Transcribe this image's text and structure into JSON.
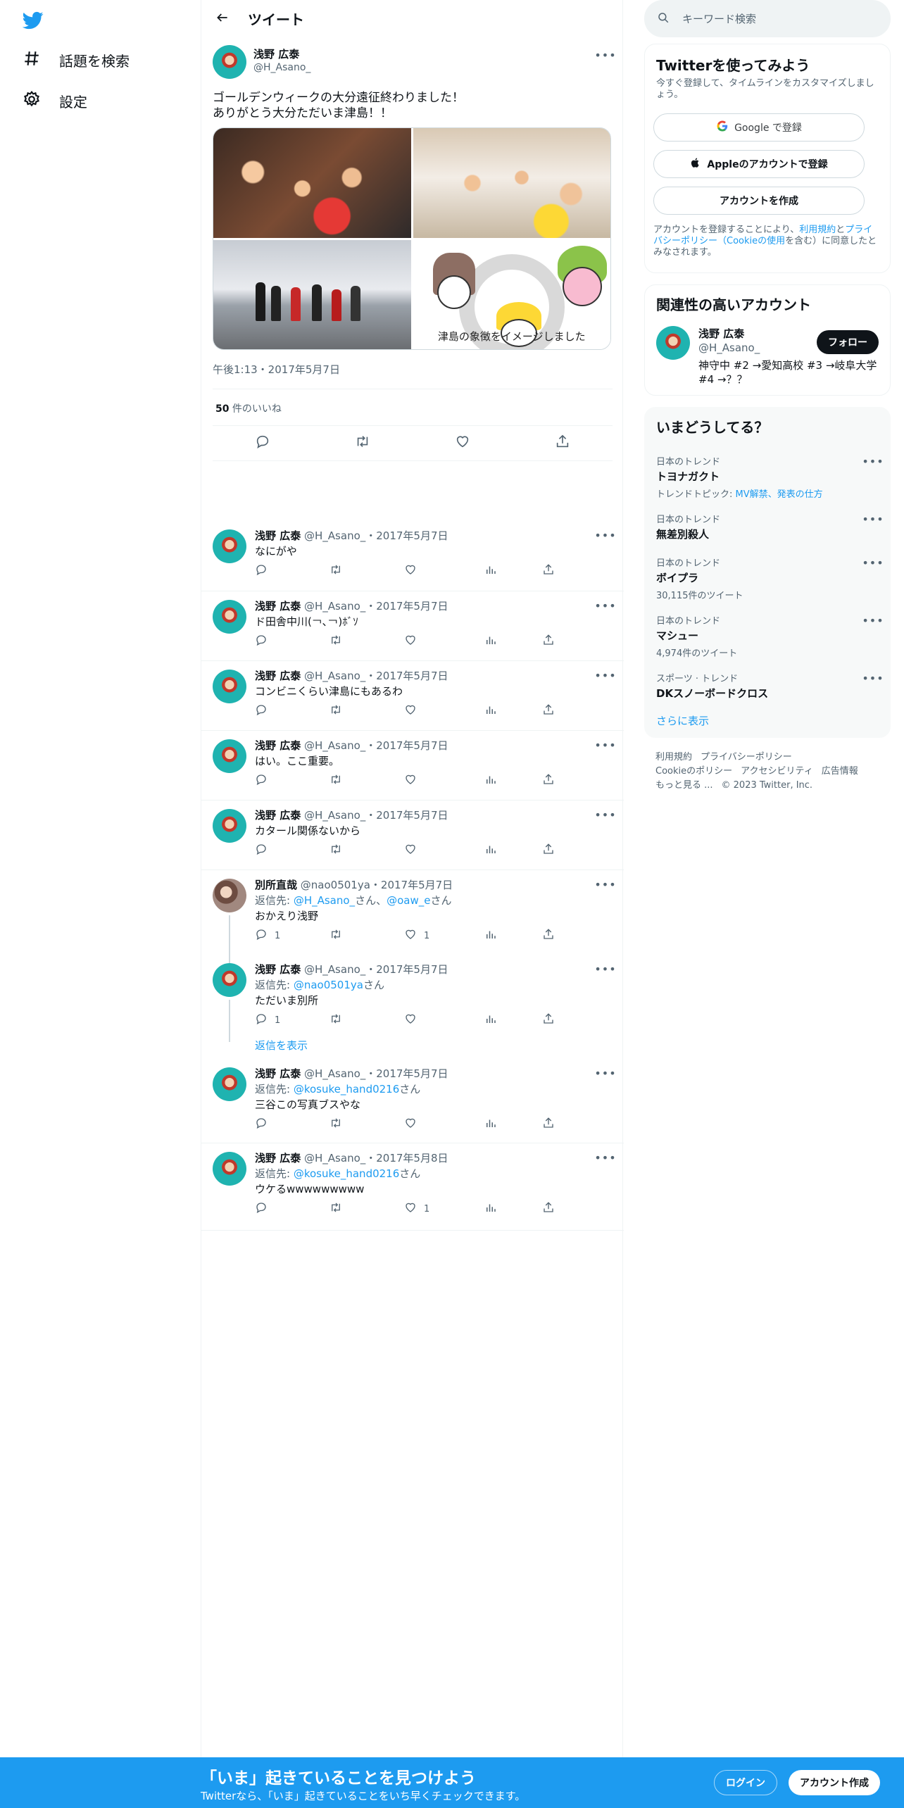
{
  "nav": {
    "explore_label": "話題を検索",
    "settings_label": "設定"
  },
  "header": {
    "title": "ツイート"
  },
  "focal_tweet": {
    "name": "浅野 広泰",
    "handle": "@H_Asano_",
    "text": "ゴールデンウィークの大分遠征終わりました！\nありがとう大分ただいま津島！！",
    "image_caption": "津島の象徴をイメージしました",
    "timestamp": "午後1:13・2017年5月7日",
    "like_count": "50",
    "like_label": " 件のいいね"
  },
  "replies": [
    {
      "name": "浅野 広泰",
      "meta": "@H_Asano_・2017年5月7日",
      "reply_to_prefix": "",
      "reply_to": "",
      "reply_to_suffix": "",
      "text": "なにがや",
      "reply_count": "",
      "like_count": ""
    },
    {
      "name": "浅野 広泰",
      "meta": "@H_Asano_・2017年5月7日",
      "reply_to_prefix": "",
      "reply_to": "",
      "reply_to_suffix": "",
      "text": "ド田舎中川(￢､￢)ﾎﾞｿ",
      "reply_count": "",
      "like_count": ""
    },
    {
      "name": "浅野 広泰",
      "meta": "@H_Asano_・2017年5月7日",
      "reply_to_prefix": "",
      "reply_to": "",
      "reply_to_suffix": "",
      "text": "コンビニくらい津島にもあるわ",
      "reply_count": "",
      "like_count": ""
    },
    {
      "name": "浅野 広泰",
      "meta": "@H_Asano_・2017年5月7日",
      "reply_to_prefix": "",
      "reply_to": "",
      "reply_to_suffix": "",
      "text": "はい。ここ重要。",
      "reply_count": "",
      "like_count": ""
    },
    {
      "name": "浅野 広泰",
      "meta": "@H_Asano_・2017年5月7日",
      "reply_to_prefix": "",
      "reply_to": "",
      "reply_to_suffix": "",
      "text": "カタール関係ないから",
      "reply_count": "",
      "like_count": ""
    },
    {
      "name": "別所直哉",
      "meta": "@nao0501ya・2017年5月7日",
      "reply_to_prefix": "返信先: ",
      "reply_to": "@H_Asano_",
      "reply_to_suffix": "さん、",
      "reply_to2": "@oaw_e",
      "reply_to_suffix2": "さん",
      "text": "おかえり浅野",
      "reply_count": "1",
      "like_count": "1"
    },
    {
      "name": "浅野 広泰",
      "meta": "@H_Asano_・2017年5月7日",
      "reply_to_prefix": "返信先: ",
      "reply_to": "@nao0501ya",
      "reply_to_suffix": "さん",
      "text": "ただいま別所",
      "reply_count": "1",
      "like_count": ""
    },
    {
      "name": "浅野 広泰",
      "meta": "@H_Asano_・2017年5月7日",
      "reply_to_prefix": "返信先: ",
      "reply_to": "@kosuke_hand0216",
      "reply_to_suffix": "さん",
      "text": "三谷この写真ブスやな",
      "reply_count": "",
      "like_count": ""
    },
    {
      "name": "浅野 広泰",
      "meta": "@H_Asano_・2017年5月8日",
      "reply_to_prefix": "返信先: ",
      "reply_to": "@kosuke_hand0216",
      "reply_to_suffix": "さん",
      "text": "ウケるwwwwwwwww",
      "reply_count": "",
      "like_count": "1"
    }
  ],
  "show_replies_label": "返信を表示",
  "sidebar": {
    "search_placeholder": "キーワード検索",
    "signup": {
      "title": "Twitterを使ってみよう",
      "subtitle": "今すぐ登録して、タイムラインをカスタマイズしましょう。",
      "google_label": "Google で登録",
      "apple_label": "Appleのアカウントで登録",
      "create_label": "アカウントを作成",
      "legal_prefix": "アカウントを登録することにより、",
      "legal_terms": "利用規約",
      "legal_and": "と",
      "legal_privacy": "プライバシーポリシー（Cookieの使用",
      "legal_suffix": "を含む）に同意したとみなされます。"
    },
    "relevant": {
      "title": "関連性の高いアカウント",
      "name": "浅野 広泰",
      "handle": "@H_Asano_",
      "bio": "神守中 #2 →愛知高校 #3 →岐阜大学 #4 →？？",
      "follow_label": "フォロー"
    },
    "trends": {
      "title": "いまどうしてる？",
      "items": [
        {
          "context": "日本のトレンド",
          "name": "トヨナガクト",
          "sub_prefix": "トレンドトピック: ",
          "sub_link": "MV解禁、発表の仕方"
        },
        {
          "context": "日本のトレンド",
          "name": "無差別殺人",
          "sub_prefix": "",
          "sub_link": ""
        },
        {
          "context": "日本のトレンド",
          "name": "ボイプラ",
          "sub_prefix": "30,115件のツイート",
          "sub_link": ""
        },
        {
          "context": "日本のトレンド",
          "name": "マシュー",
          "sub_prefix": "4,974件のツイート",
          "sub_link": ""
        },
        {
          "context": "スポーツ · トレンド",
          "name": "DKスノーボードクロス",
          "sub_prefix": "",
          "sub_link": ""
        }
      ],
      "show_more": "さらに表示"
    },
    "footer": {
      "terms": "利用規約",
      "privacy": "プライバシーポリシー",
      "cookie": "Cookieのポリシー",
      "accessibility": "アクセシビリティ",
      "ads": "広告情報",
      "more": "もっと見る ...",
      "copyright": "© 2023 Twitter, Inc."
    }
  },
  "bottom_bar": {
    "title": "「いま」起きていることを見つけよう",
    "subtitle": "Twitterなら、「いま」起きていることをいち早くチェックできます。",
    "login": "ログイン",
    "signup": "アカウント作成"
  },
  "colors": {
    "accent": "#1d9bf0",
    "text": "#0f1419",
    "secondary": "#536471"
  }
}
